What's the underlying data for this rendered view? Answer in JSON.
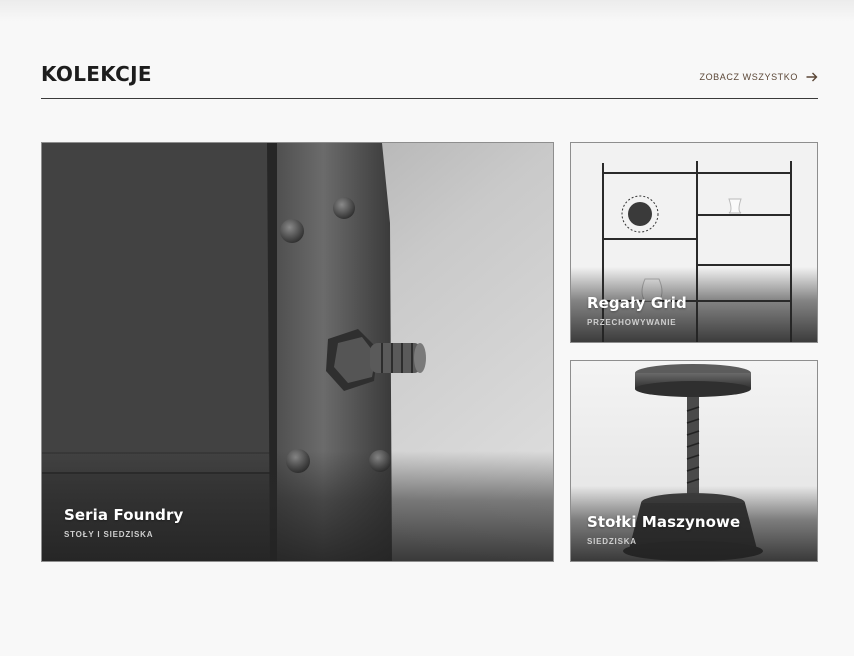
{
  "section": {
    "title": "KOLEKCJE",
    "view_all_label": "ZOBACZ WSZYSTKO",
    "view_all_icon": "arrow-right-icon"
  },
  "collections": [
    {
      "name": "Seria Foundry",
      "category": "STOŁY I SIEDZISKA",
      "image": "bolted-steel-bracket-photo"
    },
    {
      "name": "Regały Grid",
      "category": "PRZECHOWYWANIE",
      "image": "metal-shelf-photo"
    },
    {
      "name": "Stołki Maszynowe",
      "category": "SIEDZISKA",
      "image": "industrial-screw-stool-photo"
    }
  ],
  "colors": {
    "background": "#f8f8f8",
    "title": "#1d1d1d",
    "link": "#5a4636",
    "divider": "#3a3a3a"
  }
}
